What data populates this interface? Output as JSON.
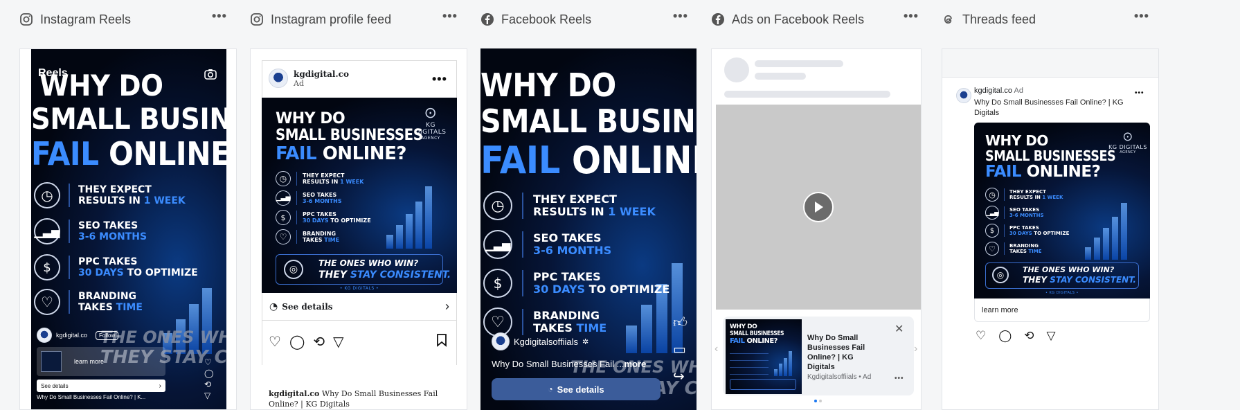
{
  "columns": [
    {
      "title": "Instagram Reels",
      "icon": "instagram-icon"
    },
    {
      "title": "Instagram profile feed",
      "icon": "instagram-icon"
    },
    {
      "title": "Facebook Reels",
      "icon": "facebook-icon"
    },
    {
      "title": "Ads on Facebook Reels",
      "icon": "facebook-icon"
    },
    {
      "title": "Threads feed",
      "icon": "threads-icon"
    }
  ],
  "creative": {
    "line1": "WHY DO",
    "line2": "SMALL BUSINESSES",
    "line3a": "FAIL",
    "line3b": "ONLINE?",
    "items": [
      {
        "a": "THEY EXPECT",
        "b1": "RESULTS IN ",
        "b2": "1 WEEK",
        "b3": "",
        "icon": "clock-icon"
      },
      {
        "a": "SEO TAKES",
        "b1": "",
        "b2": "3-6 MONTHS",
        "b3": "",
        "icon": "chart-icon"
      },
      {
        "a": "PPC TAKES",
        "b1": "",
        "b2": "30 DAYS",
        "b3": " TO OPTIMIZE",
        "icon": "dollar-click-icon"
      },
      {
        "a": "BRANDING",
        "b1": "TAKES ",
        "b2": "TIME",
        "b3": "",
        "icon": "heart-icon"
      }
    ],
    "win1": "THE ONES WHO WIN?",
    "win2a": "THEY ",
    "win2b": "STAY CONSISTENT.",
    "brand_logo": "KG DIGITALS",
    "brand_sub": "AGENCY",
    "footer": "• KG DIGITALS •"
  },
  "ig_reels": {
    "label": "Reels",
    "account": "kgdigital.co",
    "follow": "Follow",
    "learn_more": "learn more",
    "see_details": "See details",
    "caption": "Why Do Small Businesses Fail Online? | K..."
  },
  "ig_feed": {
    "account": "kgdigital.co",
    "sponsored": "Ad",
    "see_details": "See details",
    "caption_account": "kgdigital.co",
    "caption": "Why Do Small Businesses Fail Online? | KG Digitals"
  },
  "fb_reels": {
    "account": "Kgdigitalsoffiials",
    "caption": "Why Do Small Businesses Fail ...",
    "more": "more",
    "see_details": "See details"
  },
  "fb_ads_reels": {
    "ad_title": "Why Do Small Businesses Fail Online? | KG Digitals",
    "advertiser": "Kgdigitalsoffiials",
    "ad_tag": "Ad"
  },
  "threads": {
    "account": "kgdigital.co",
    "ad_tag": "Ad",
    "caption": "Why Do Small Businesses Fail Online? | KG Digitals",
    "learn_more": "learn more"
  },
  "colors": {
    "accent_blue": "#3b8cff",
    "fb_button": "#3b5c9a",
    "bg": "#f5f6f7"
  }
}
